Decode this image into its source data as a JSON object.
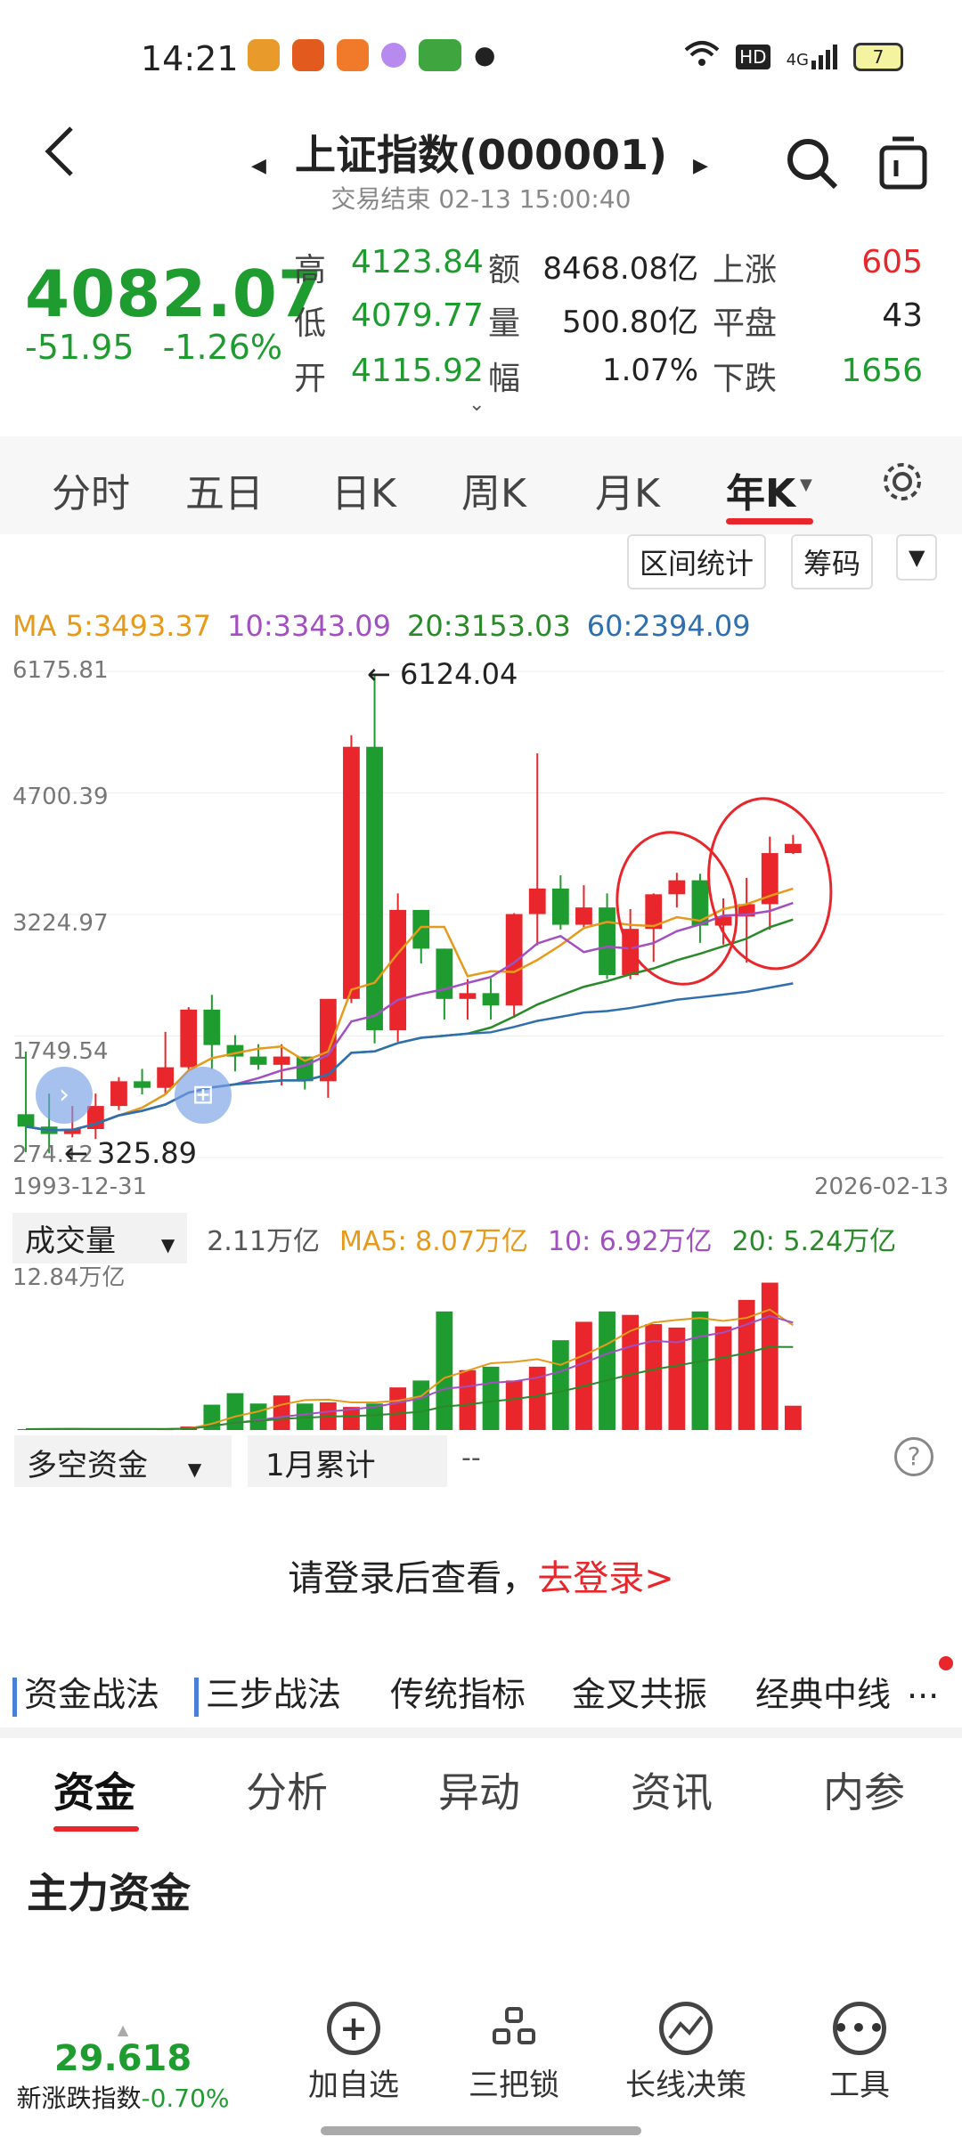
{
  "status": {
    "time": "14:21",
    "battery": "7",
    "net": "4G",
    "hd": "HD"
  },
  "header": {
    "title": "上证指数(000001)",
    "subtitle": "交易结束 02-13 15:00:40"
  },
  "quote": {
    "price": "4082.07",
    "change": "-51.95",
    "change_pct": "-1.26%",
    "high_label": "高",
    "high": "4123.84",
    "low_label": "低",
    "low": "4079.77",
    "open_label": "开",
    "open": "4115.92",
    "amount_label": "额",
    "amount": "8468.08亿",
    "volume_label": "量",
    "volume": "500.80亿",
    "amplitude_label": "幅",
    "amplitude": "1.07%",
    "up_label": "上涨",
    "up": "605",
    "flat_label": "平盘",
    "flat": "43",
    "down_label": "下跌",
    "down": "1656"
  },
  "tabs": [
    "分时",
    "五日",
    "日K",
    "周K",
    "月K",
    "年K"
  ],
  "tools": {
    "range_stats": "区间统计",
    "chips": "筹码"
  },
  "ma": {
    "ma5": "MA 5:3493.37",
    "ma10": "10:3343.09",
    "ma20": "20:3153.03",
    "ma60": "60:2394.09"
  },
  "axis": {
    "y_top": "6175.81",
    "y2": "4700.39",
    "y3": "3224.97",
    "y4": "1749.54",
    "y_bottom": "274.12",
    "max_label": "6124.04",
    "min_label": "325.89",
    "x_start": "1993-12-31",
    "x_end": "2026-02-13"
  },
  "volume": {
    "label": "成交量",
    "current": "2.11万亿",
    "ma5": "MA5: 8.07万亿",
    "ma10": "10: 6.92万亿",
    "ma20": "20: 5.24万亿",
    "y_top": "12.84万亿"
  },
  "capital": {
    "label": "多空资金",
    "period": "1月累计",
    "value": "--"
  },
  "login": {
    "prompt": "请登录后查看，",
    "link": "去登录>"
  },
  "strategies": [
    "资金战法",
    "三步战法",
    "传统指标",
    "金叉共振",
    "经典中线",
    "..."
  ],
  "tabs2": [
    "资金",
    "分析",
    "异动",
    "资讯",
    "内参"
  ],
  "section_title": "主力资金",
  "bottom": {
    "index_value": "29.618",
    "index_label": "新涨跌指数",
    "index_change": "-0.70%",
    "items": [
      "加自选",
      "三把锁",
      "长线决策",
      "工具"
    ]
  },
  "colors": {
    "up": "#e8262b",
    "down": "#1f9c2f",
    "ma5": "#e69a1b",
    "ma10": "#a24fc2",
    "ma20": "#2a8a2a",
    "ma60": "#2f6fb0"
  },
  "chart_data": {
    "type": "candlestick",
    "period": "yearly",
    "ylim": [
      274.12,
      6175.81
    ],
    "candles": [
      {
        "o": 800,
        "h": 1560,
        "l": 340,
        "c": 650
      },
      {
        "o": 650,
        "h": 1050,
        "l": 326,
        "c": 560
      },
      {
        "o": 560,
        "h": 900,
        "l": 520,
        "c": 620
      },
      {
        "o": 620,
        "h": 1050,
        "l": 500,
        "c": 900
      },
      {
        "o": 900,
        "h": 1250,
        "l": 850,
        "c": 1200
      },
      {
        "o": 1200,
        "h": 1350,
        "l": 1040,
        "c": 1120
      },
      {
        "o": 1120,
        "h": 1800,
        "l": 1050,
        "c": 1370
      },
      {
        "o": 1370,
        "h": 2100,
        "l": 1340,
        "c": 2070
      },
      {
        "o": 2070,
        "h": 2250,
        "l": 1350,
        "c": 1640
      },
      {
        "o": 1640,
        "h": 1760,
        "l": 1320,
        "c": 1500
      },
      {
        "o": 1500,
        "h": 1650,
        "l": 1340,
        "c": 1400
      },
      {
        "o": 1400,
        "h": 1650,
        "l": 1150,
        "c": 1500
      },
      {
        "o": 1500,
        "h": 1430,
        "l": 1100,
        "c": 1200
      },
      {
        "o": 1200,
        "h": 2200,
        "l": 1000,
        "c": 2200
      },
      {
        "o": 2200,
        "h": 5400,
        "l": 2150,
        "c": 5260
      },
      {
        "o": 5260,
        "h": 6124,
        "l": 1660,
        "c": 1820
      },
      {
        "o": 1820,
        "h": 3480,
        "l": 1680,
        "c": 3280
      },
      {
        "o": 3280,
        "h": 3180,
        "l": 2630,
        "c": 2810
      },
      {
        "o": 2810,
        "h": 2480,
        "l": 1950,
        "c": 2200
      },
      {
        "o": 2200,
        "h": 2440,
        "l": 1950,
        "c": 2270
      },
      {
        "o": 2270,
        "h": 2450,
        "l": 1950,
        "c": 2120
      },
      {
        "o": 2120,
        "h": 3240,
        "l": 1970,
        "c": 3230
      },
      {
        "o": 3230,
        "h": 5180,
        "l": 2850,
        "c": 3540
      },
      {
        "o": 3540,
        "h": 3700,
        "l": 3040,
        "c": 3100
      },
      {
        "o": 3100,
        "h": 3580,
        "l": 3050,
        "c": 3310
      },
      {
        "o": 3310,
        "h": 3480,
        "l": 2440,
        "c": 2490
      },
      {
        "o": 2490,
        "h": 3290,
        "l": 2440,
        "c": 3050
      },
      {
        "o": 3050,
        "h": 3480,
        "l": 2650,
        "c": 3470
      },
      {
        "o": 3470,
        "h": 3730,
        "l": 3310,
        "c": 3640
      },
      {
        "o": 3640,
        "h": 3720,
        "l": 2880,
        "c": 3090
      },
      {
        "o": 3090,
        "h": 3420,
        "l": 2860,
        "c": 3200
      },
      {
        "o": 3200,
        "h": 3670,
        "l": 2640,
        "c": 3350
      },
      {
        "o": 3350,
        "h": 4170,
        "l": 3040,
        "c": 3970
      },
      {
        "o": 3970,
        "h": 4190,
        "l": 3960,
        "c": 4082
      }
    ],
    "volumes": [
      0.05,
      0.05,
      0.05,
      0.05,
      0.05,
      0.05,
      0.08,
      0.1,
      0.1,
      0.08,
      0.08,
      0.08,
      0.07,
      0.3,
      2.2,
      3.2,
      2.3,
      3.0,
      2.3,
      2.4,
      2.0,
      2.3,
      3.7,
      4.3,
      10.3,
      5.2,
      5.5,
      4.3,
      5.5,
      7.8,
      9.4,
      10.3,
      10.0,
      9.2,
      8.9,
      10.3,
      9.0,
      11.3,
      12.8,
      2.11
    ],
    "vol_ylim": [
      0,
      12.84
    ]
  }
}
